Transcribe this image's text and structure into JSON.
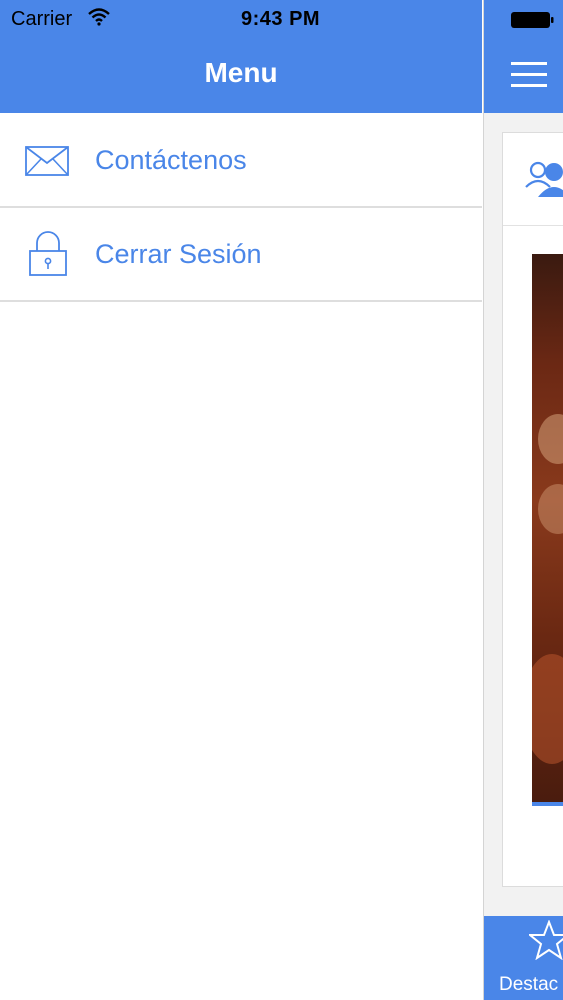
{
  "status_bar": {
    "carrier": "Carrier",
    "time": "9:43 PM",
    "wifi_icon": "wifi-icon",
    "battery_icon": "battery-icon"
  },
  "drawer": {
    "title": "Menu",
    "items": [
      {
        "label": "Contáctenos",
        "icon": "envelope-icon"
      },
      {
        "label": "Cerrar Sesión",
        "icon": "lock-icon"
      }
    ]
  },
  "main": {
    "menu_icon": "hamburger-icon",
    "card_icon": "group-icon",
    "tab_bar": {
      "items": [
        {
          "label": "Destac",
          "icon": "star-icon"
        }
      ]
    }
  },
  "colors": {
    "accent": "#4a86e8",
    "background": "#ffffff",
    "divider": "#dedede"
  }
}
